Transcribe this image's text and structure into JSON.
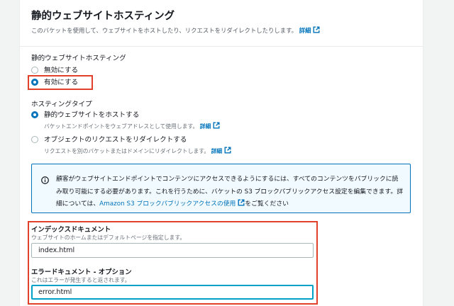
{
  "section": {
    "title": "静的ウェブサイトホスティング",
    "description": "このバケットを使用して、ウェブサイトをホストしたり、リクエストをリダイレクトしたりします。",
    "details_link": "詳細"
  },
  "hosting_toggle": {
    "label": "静的ウェブサイトホスティング",
    "options": [
      {
        "label": "無効にする",
        "selected": false
      },
      {
        "label": "有効にする",
        "selected": true
      }
    ]
  },
  "hosting_type": {
    "label": "ホスティングタイプ",
    "options": [
      {
        "label": "静的ウェブサイトをホストする",
        "description": "バケットエンドポイントをウェブアドレスとして使用します。",
        "link": "詳細",
        "selected": true
      },
      {
        "label": "オブジェクトのリクエストをリダイレクトする",
        "description": "リクエストを別のバケットまたはドメインにリダイレクトします。",
        "link": "詳細",
        "selected": false
      }
    ]
  },
  "alert": {
    "text_before": "顧客がウェブサイトエンドポイントでコンテンツにアクセスできるようにするには、すべてのコンテンツをパブリックに読み取り可能にする必要があります。これを行うために、バケットの S3 ブロックパブリックアクセス設定を編集できます。詳細については、",
    "link_text": "Amazon S3 ブロックパブリックアクセスの使用",
    "text_after": "をご覧ください"
  },
  "index_document": {
    "label": "インデックスドキュメント",
    "description": "ウェブサイトのホームまたはデフォルトページを指定します。",
    "value": "index.html"
  },
  "error_document": {
    "label": "エラードキュメント - オプション",
    "description": "これはエラーが発生すると返されます。",
    "value": "error.html"
  },
  "colors": {
    "accent": "#0073bb",
    "highlight_box": "#e1402b",
    "focus": "#00a1c9"
  }
}
